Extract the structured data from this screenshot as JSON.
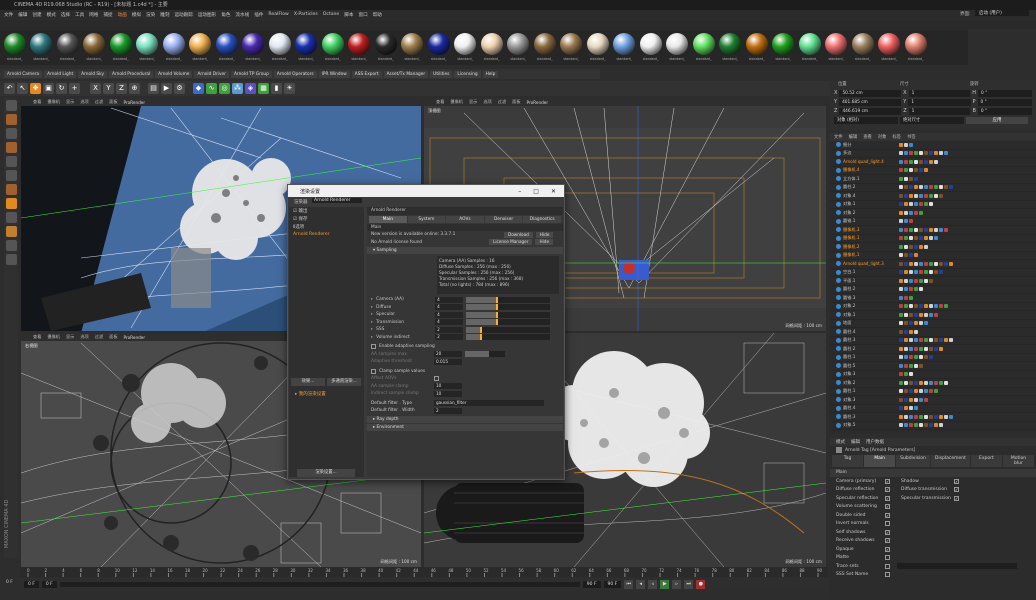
{
  "title": "CINEMA 4D R19.068 Studio (RC - R19) - [未标题 1.c4d *] - 主要",
  "menu": [
    "文件",
    "编辑",
    "创建",
    "模式",
    "选择",
    "工具",
    "网格",
    "捕捉",
    "动画",
    "模拟",
    "渲染",
    "雕刻",
    "运动跟踪",
    "运动图形",
    "角色",
    "流水线",
    "插件",
    "RealFlow",
    "X-Particles",
    "Octane",
    "脚本",
    "窗口",
    "帮助"
  ],
  "layout_label": "界面:",
  "layout_value": "启动 (用户)",
  "materials": [
    {
      "label": "standard_",
      "color": "#1f8a2a"
    },
    {
      "label": "standard_",
      "color": "#2f7a80"
    },
    {
      "label": "standard_",
      "color": "#555"
    },
    {
      "label": "standard_",
      "color": "#8a6a3a"
    },
    {
      "label": "standard_",
      "color": "#1a9a2a"
    },
    {
      "label": "standard_",
      "color": "#7ae0c0"
    },
    {
      "label": "standard_",
      "color": "#9ab0f0"
    },
    {
      "label": "standard_",
      "color": "#f0b050"
    },
    {
      "label": "standard_",
      "color": "#2a50c0"
    },
    {
      "label": "standard_",
      "color": "#4a2ab0"
    },
    {
      "label": "standard_",
      "color": "#e0e8f0"
    },
    {
      "label": "standard_",
      "color": "#1a30b0"
    },
    {
      "label": "standard_",
      "color": "#40d060"
    },
    {
      "label": "standard_",
      "color": "#c02020"
    },
    {
      "label": "standard_",
      "color": "#2a2a2a"
    },
    {
      "label": "standard_",
      "color": "#a08050"
    },
    {
      "label": "standard_",
      "color": "#1a2aa0"
    },
    {
      "label": "standard_",
      "color": "#f0f0f0"
    },
    {
      "label": "standard_",
      "color": "#f0d0b0"
    },
    {
      "label": "standard_",
      "color": "#9a9a9a"
    },
    {
      "label": "standard_",
      "color": "#8a6a40"
    },
    {
      "label": "standard_",
      "color": "#9a7a50"
    },
    {
      "label": "standard_",
      "color": "#e8d8c0"
    },
    {
      "label": "standard_",
      "color": "#70a0e0"
    },
    {
      "label": "standard_",
      "color": "#f0f0f0"
    },
    {
      "label": "standard_",
      "color": "#e8e8e8"
    },
    {
      "label": "standard_",
      "color": "#60e060"
    },
    {
      "label": "standard_",
      "color": "#208030"
    },
    {
      "label": "standard_",
      "color": "#c07010"
    },
    {
      "label": "standard_",
      "color": "#20a020"
    },
    {
      "label": "standard_",
      "color": "#60e090"
    },
    {
      "label": "standard_",
      "color": "#f07070"
    },
    {
      "label": "standard_",
      "color": "#9a8060"
    },
    {
      "label": "standard_",
      "color": "#f06060"
    },
    {
      "label": "standard_",
      "color": "#e08070"
    }
  ],
  "plugin_bar": [
    "Arnold Camera",
    "Arnold Light",
    "Arnold Sky",
    "Arnold Procedural",
    "Arnold Volume",
    "Arnold Driver",
    "Arnold TP Group",
    "Arnold Operators",
    "IPR Window",
    "ASS Export",
    "Asset/Tx Manager",
    "Utilities",
    "Licensing",
    "Help"
  ],
  "toolbar_icons": [
    "X",
    "Y",
    "Z"
  ],
  "viewports": [
    {
      "label": "透视视图",
      "menu": [
        "查看",
        "摄像机",
        "显示",
        "选项",
        "过滤",
        "面板",
        "ProRender"
      ],
      "footer": ""
    },
    {
      "label": "顶视图",
      "menu": [
        "查看",
        "摄像机",
        "显示",
        "选项",
        "过滤",
        "面板",
        "ProRender"
      ],
      "footer": "网格间距 : 100 cm"
    },
    {
      "label": "右视图",
      "menu": [
        "查看",
        "摄像机",
        "显示",
        "选项",
        "过滤",
        "面板",
        "ProRender"
      ],
      "footer": "网格间距 : 100 cm"
    },
    {
      "label": "",
      "menu": [],
      "footer": "网格间距 : 100 cm"
    }
  ],
  "render_settings": {
    "title": "渲染设置",
    "renderer_label": "渲染器",
    "renderer": "Arnold Renderer",
    "left_items": [
      "输出",
      "保存",
      "Ⅱ选项",
      "Arnold Renderer"
    ],
    "effect_btn": "效果...",
    "multi_pass_btn": "多通道渲染...",
    "my_render_setting": "我的渲染设置",
    "render_setting_btn": "渲染设置...",
    "panel_title": "Arnold Renderer",
    "tabs": [
      "Main",
      "System",
      "AOVs",
      "Denoiser",
      "Diagnostics"
    ],
    "main_label": "Main",
    "version_text": "New version is available online: 3.3.7.1",
    "download_btn": "Download",
    "hide_btn": "Hide",
    "license_text": "No Arnold license found",
    "license_btn": "License Manager",
    "sampling_label": "Sampling",
    "samples_info": [
      "Camera (AA) Samples : 16",
      "Diffuse Samples : 256 (max : 256)",
      "Specular Samples : 256 (max : 256)",
      "Transmission Samples : 256 (max : 368)",
      "Total (no lights) : 784 (max : 896)"
    ],
    "sample_rows": [
      {
        "label": "Camera (AA)",
        "value": "4",
        "fill": 0.35
      },
      {
        "label": "Diffuse",
        "value": "4",
        "fill": 0.35
      },
      {
        "label": "Specular",
        "value": "4",
        "fill": 0.35
      },
      {
        "label": "Transmission",
        "value": "4",
        "fill": 0.35
      },
      {
        "label": "SSS",
        "value": "2",
        "fill": 0.17
      },
      {
        "label": "Volume indirect",
        "value": "2",
        "fill": 0.17
      }
    ],
    "adaptive_label": "Enable adaptive sampling",
    "adaptive_rows": [
      {
        "label": "AA samples max",
        "value": "20"
      },
      {
        "label": "Adaptive threshold",
        "value": "0.015"
      }
    ],
    "clamp_label": "Clamp sample values",
    "clamp_rows": [
      {
        "label": "Affect AOVs",
        "value": ""
      },
      {
        "label": "AA sample clamp",
        "value": "10"
      },
      {
        "label": "Indirect sample clamp",
        "value": "10"
      }
    ],
    "filter_type_label": "Default filter . Type",
    "filter_type": "gaussian_filter",
    "filter_width_label": "Default filter . Width",
    "filter_width": "2",
    "ray_depth": "Ray depth",
    "environment": "Environment"
  },
  "coords": {
    "headers": [
      "位置",
      "尺寸",
      "旋转"
    ],
    "rows": [
      {
        "a": "X",
        "v": "50.52 cm",
        "b": "X",
        "s": "1",
        "c": "H",
        "r": "0 °"
      },
      {
        "a": "Y",
        "v": "401.685 cm",
        "b": "Y",
        "s": "1",
        "c": "P",
        "r": "0 °"
      },
      {
        "a": "Z",
        "v": "446.619 cm",
        "b": "Z",
        "s": "1",
        "c": "B",
        "r": "0 °"
      }
    ],
    "mode_label": "对象 (相对)",
    "scale_label": "绝对尺寸",
    "apply": "应用"
  },
  "objects_tabs": [
    "文件",
    "编辑",
    "查看",
    "对象",
    "标签",
    "书签"
  ],
  "objects": [
    "细分",
    "多边",
    "Arnold quad_light.4",
    "摄像机.4",
    "立方体.1",
    "圆柱.2",
    "对象.4",
    "对象.1",
    "对象.2",
    "圆锥.1",
    "摄像机.3",
    "摄像机.1",
    "摄像机.2",
    "摄像机.1",
    "Arnold quad_light.3",
    "空白.1",
    "平面.1",
    "圆柱.2",
    "圆锥.3",
    "对象.2",
    "对象.1",
    "地面",
    "圆柱.4",
    "圆柱.3",
    "圆柱.2",
    "圆柱.1",
    "圆柱.5",
    "对象.3",
    "对象.2",
    "圆柱.1",
    "对象.3",
    "圆柱.4",
    "圆柱.3",
    "对象.5"
  ],
  "attr": {
    "menu": [
      "模式",
      "编辑",
      "用户数据"
    ],
    "tag_title": "Arnold Tag [Arnold Parameters]",
    "tabs": [
      "Tag",
      "Main",
      "Subdivision",
      "Displacement",
      "Export",
      "Motion blur"
    ],
    "section": "Main",
    "rows": [
      {
        "label": "Camera (primary)",
        "checked": "✓",
        "label2": "Shadow",
        "checked2": "✓"
      },
      {
        "label": "Diffuse reflection",
        "checked": "✓",
        "label2": "Diffuse transmission",
        "checked2": "✓"
      },
      {
        "label": "Specular reflection",
        "checked": "✓",
        "label2": "Specular transmission",
        "checked2": "✓"
      },
      {
        "label": "Volume scattering",
        "checked": "✓",
        "label2": "",
        "checked2": ""
      },
      {
        "label": "Double sided",
        "checked": "✓",
        "label2": "",
        "checked2": ""
      },
      {
        "label": "Invert normals",
        "checked": "",
        "label2": "",
        "checked2": ""
      },
      {
        "label": "Self shadows",
        "checked": "✓",
        "label2": "",
        "checked2": ""
      },
      {
        "label": "Receive shadows",
        "checked": "✓",
        "label2": "",
        "checked2": ""
      },
      {
        "label": "Opaque",
        "checked": "✓",
        "label2": "",
        "checked2": ""
      },
      {
        "label": "Matte",
        "checked": "",
        "label2": "",
        "checked2": ""
      },
      {
        "label": "Trace sets",
        "checked": "",
        "label2": "",
        "checked2": ""
      },
      {
        "label": "SSS Set Name",
        "checked": "",
        "label2": "",
        "checked2": ""
      }
    ]
  },
  "timeline": {
    "ticks": [
      "0",
      "2",
      "4",
      "6",
      "8",
      "10",
      "12",
      "14",
      "16",
      "18",
      "20",
      "22",
      "24",
      "26",
      "28",
      "30",
      "32",
      "34",
      "36",
      "38",
      "40",
      "42",
      "44",
      "46",
      "48",
      "50",
      "52",
      "54",
      "56",
      "58",
      "60",
      "62",
      "64",
      "66",
      "68",
      "70",
      "72",
      "74",
      "76",
      "78",
      "80",
      "82",
      "84",
      "86",
      "88",
      "90"
    ],
    "start": "0 F",
    "current": "0 F",
    "end": "90 F",
    "end2": "90 F",
    "frame_label": "0 F"
  },
  "brand": "MAXON CINEMA 4D"
}
